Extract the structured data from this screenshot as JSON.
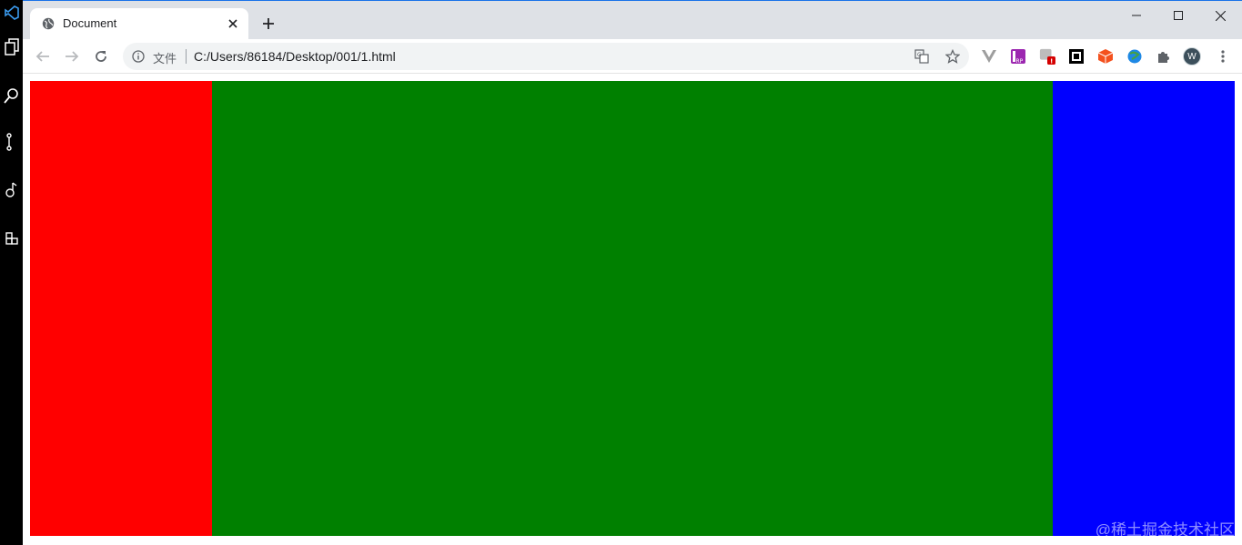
{
  "tab": {
    "title": "Document"
  },
  "address_bar": {
    "scheme_label": "文件",
    "url": "C:/Users/86184/Desktop/001/1.html"
  },
  "profile": {
    "initial": "W"
  },
  "extensions": {
    "axure_label": "RP",
    "badge": "!"
  },
  "page": {
    "columns": [
      {
        "name": "left",
        "color": "#ff0000"
      },
      {
        "name": "main",
        "color": "#008000"
      },
      {
        "name": "right",
        "color": "#0000ff"
      }
    ]
  },
  "watermark": "@稀土掘金技术社区"
}
